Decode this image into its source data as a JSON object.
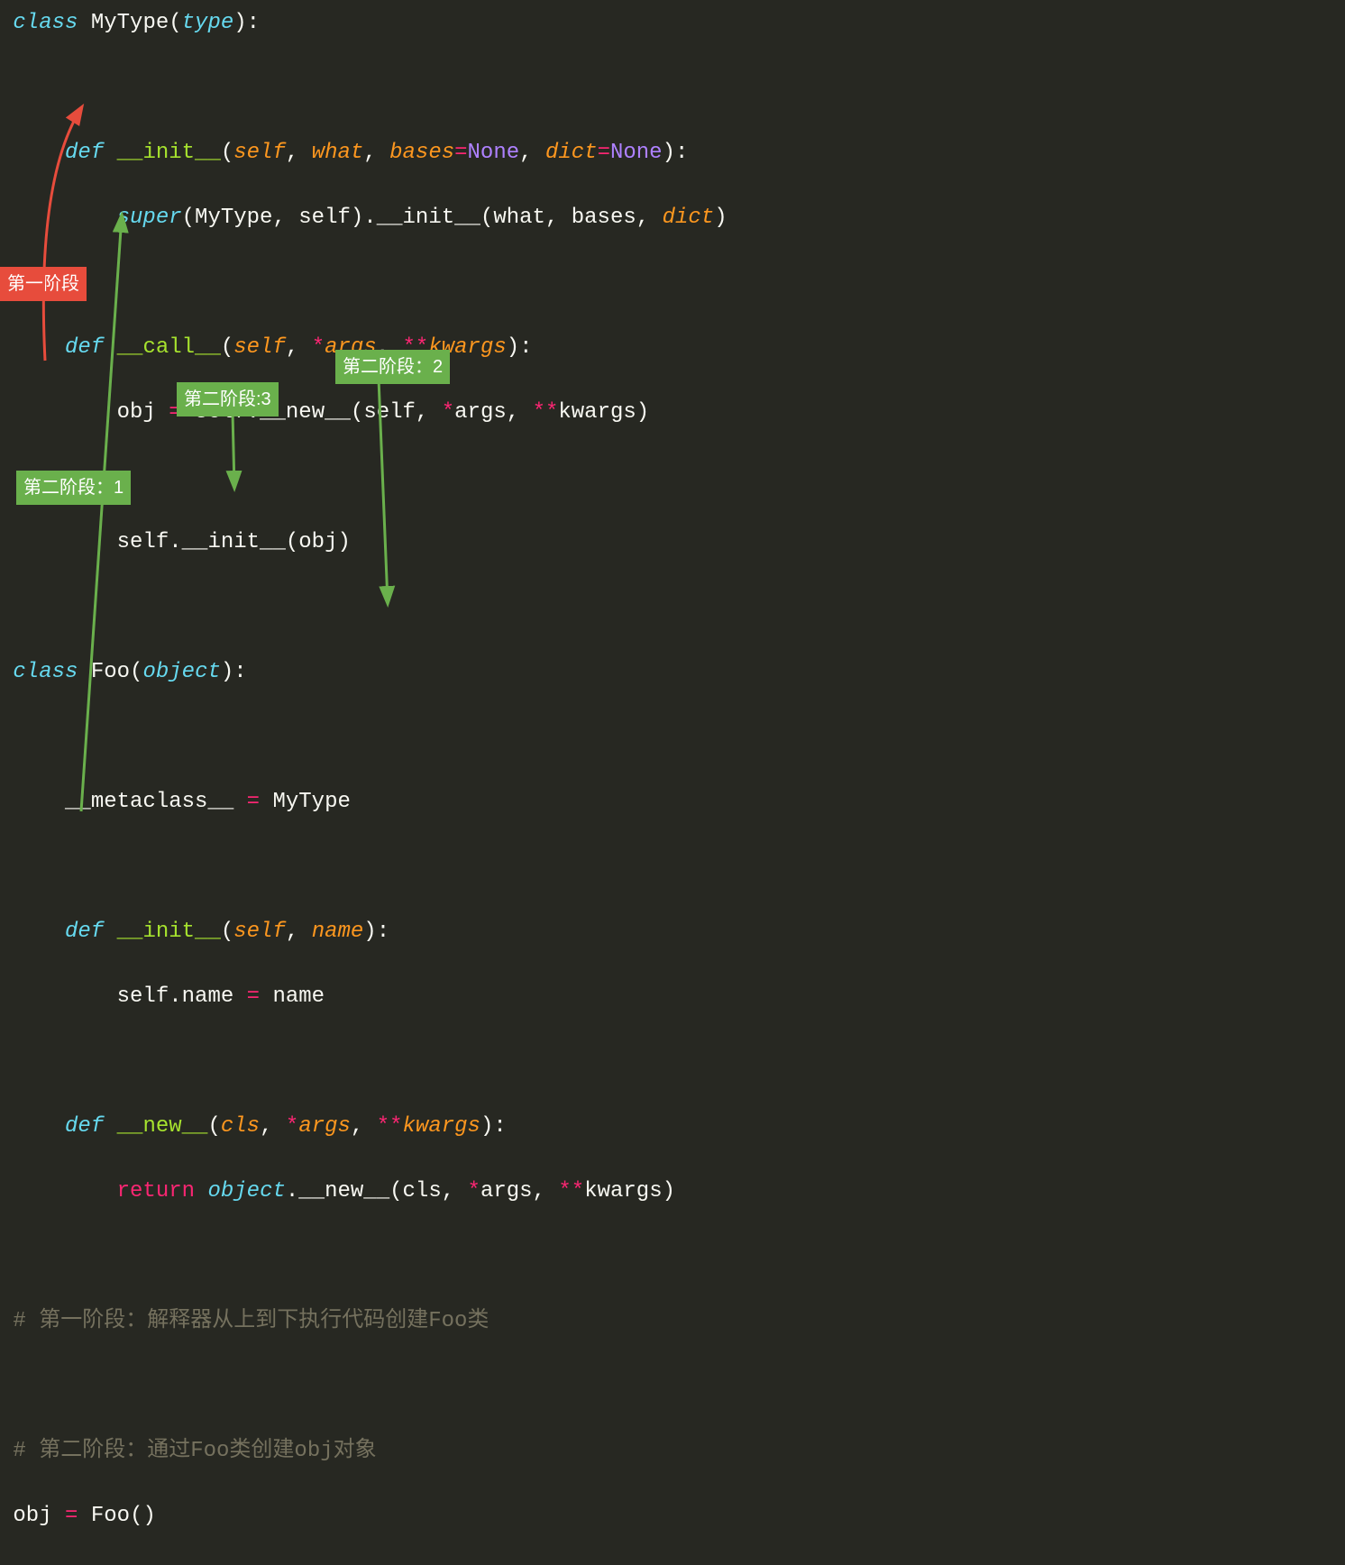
{
  "code": {
    "l1": {
      "kw": "class",
      "name": "MyType",
      "base": "type"
    },
    "l3": {
      "kw": "def",
      "fn": "__init__",
      "p_self": "self",
      "p_what": "what",
      "p_bases": "bases",
      "eq1": "=",
      "none1": "None",
      "p_dict": "dict",
      "eq2": "=",
      "none2": "None"
    },
    "l4": {
      "super": "super",
      "arg1": "MyType",
      "arg2": "self",
      "method": "__init__",
      "a1": "what",
      "a2": "bases",
      "a3": "dict"
    },
    "l6": {
      "kw": "def",
      "fn": "__call__",
      "p_self": "self",
      "star": "*",
      "args": "args",
      "dstar": "**",
      "kwargs": "kwargs"
    },
    "l7": {
      "lhs": "obj",
      "eq": "=",
      "self": "self",
      "method": "__new__",
      "a1": "self",
      "star": "*",
      "a2": "args",
      "dstar": "**",
      "a3": "kwargs"
    },
    "l9": {
      "self": "self",
      "method": "__init__",
      "a1": "obj"
    },
    "l11": {
      "kw": "class",
      "name": "Foo",
      "base": "object"
    },
    "l13": {
      "lhs": "__metaclass__",
      "eq": "=",
      "rhs": "MyType"
    },
    "l15": {
      "kw": "def",
      "fn": "__init__",
      "p_self": "self",
      "p_name": "name"
    },
    "l16": {
      "self": "self",
      "dot": ".",
      "attr": "name",
      "eq": "=",
      "rhs": "name"
    },
    "l18": {
      "kw": "def",
      "fn": "__new__",
      "p_cls": "cls",
      "star": "*",
      "args": "args",
      "dstar": "**",
      "kwargs": "kwargs"
    },
    "l19": {
      "ret": "return",
      "obj": "object",
      "method": "__new__",
      "a1": "cls",
      "star": "*",
      "a2": "args",
      "dstar": "**",
      "a3": "kwargs"
    },
    "l21": {
      "text": "# 第一阶段：解释器从上到下执行代码创建Foo类"
    },
    "l23": {
      "text": "# 第二阶段：通过Foo类创建obj对象"
    },
    "l24": {
      "lhs": "obj",
      "eq": "=",
      "call": "Foo"
    }
  },
  "annotations": {
    "stage1": "第一阶段",
    "stage2_1": "第二阶段：1",
    "stage2_2": "第二阶段：2",
    "stage2_3": "第二阶段:3"
  },
  "colors": {
    "bg": "#272822",
    "arrow_red": "#e74c3c",
    "arrow_green": "#6ab04c"
  }
}
